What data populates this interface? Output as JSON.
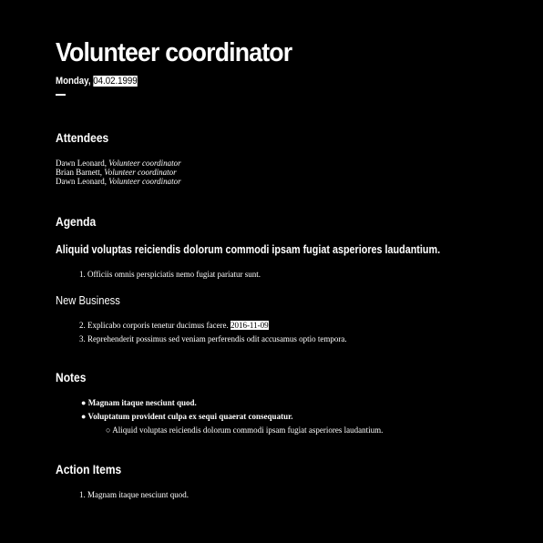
{
  "title": "Volunteer coordinator",
  "date": {
    "weekday": "Monday,",
    "value": "04.02.1999"
  },
  "attendees": {
    "heading": "Attendees",
    "people": [
      {
        "name": "Dawn Leonard,",
        "role": "Volunteer coordinator"
      },
      {
        "name": "Brian Barnett,",
        "role": "Volunteer coordinator"
      },
      {
        "name": "Dawn Leonard,",
        "role": "Volunteer coordinator"
      }
    ]
  },
  "agenda": {
    "heading": "Agenda",
    "subheading": "Aliquid voluptas reiciendis dolorum commodi ipsam fugiat asperiores laudantium.",
    "items": [
      {
        "marker": "1.",
        "text": "Officiis omnis perspiciatis nemo fugiat pariatur sunt."
      }
    ],
    "new_business": {
      "heading": "New Business",
      "items": [
        {
          "marker": "2.",
          "text": "Explicabo corporis tenetur ducimus facere.",
          "date": "2016-11-09"
        },
        {
          "marker": "3.",
          "text": "Reprehenderit possimus sed veniam perferendis odit accusamus optio tempora."
        }
      ]
    }
  },
  "notes": {
    "heading": "Notes",
    "items": [
      {
        "marker": "●",
        "text": "Magnam itaque nesciunt quod."
      },
      {
        "marker": "●",
        "text": "Voluptatum provident culpa ex sequi quaerat consequatur."
      }
    ],
    "subitems": [
      {
        "marker": "○",
        "text": "Aliquid voluptas reiciendis dolorum commodi ipsam fugiat asperiores laudantium."
      }
    ]
  },
  "action_items": {
    "heading": "Action Items",
    "items": [
      {
        "marker": "1.",
        "text": "Magnam itaque nesciunt quod."
      }
    ]
  }
}
